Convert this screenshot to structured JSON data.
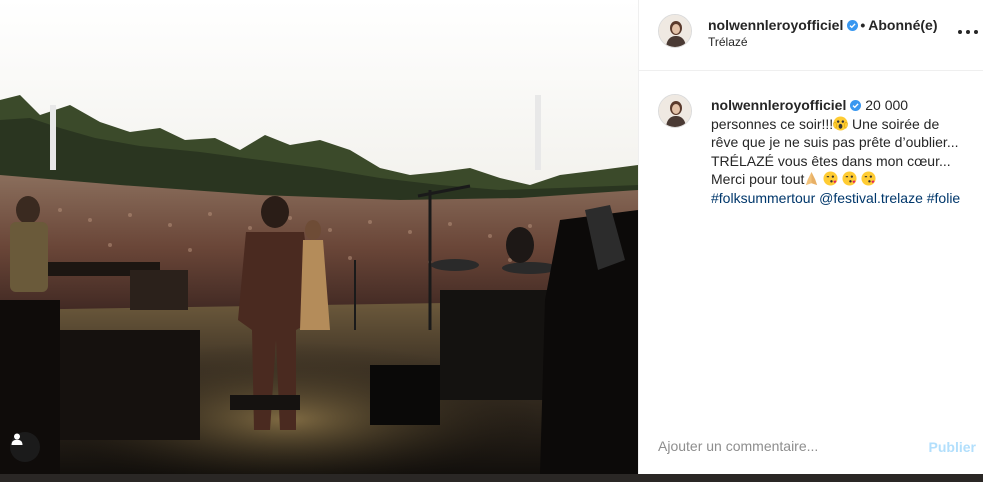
{
  "post": {
    "username": "nolwennleroyofficiel",
    "follow_status": "Abonné(e)",
    "separator": "•",
    "location": "Trélazé",
    "caption_user": "nolwennleroyofficiel",
    "caption_text_1": " 20 000 personnes ce soir!!!",
    "caption_text_2": " Une soirée de rêve que je ne suis pas prête d’oublier... TRÉLAZÉ vous êtes dans mon cœur... Merci pour tout",
    "caption_hashtag_1": "#folksummertour",
    "caption_mention": "@festival.trelaze",
    "caption_hashtag_2": "#folie",
    "emoji_icons": [
      "face-screaming-icon",
      "folded-hands-icon",
      "face-blowing-kiss-icon",
      "face-blowing-kiss-icon",
      "face-blowing-kiss-icon"
    ]
  },
  "comment_box": {
    "placeholder": "Ajouter un commentaire...",
    "post_label": "Publier"
  },
  "colors": {
    "verified": "#3897f0",
    "link": "#00376b",
    "publish_disabled": "#b2dffc"
  }
}
